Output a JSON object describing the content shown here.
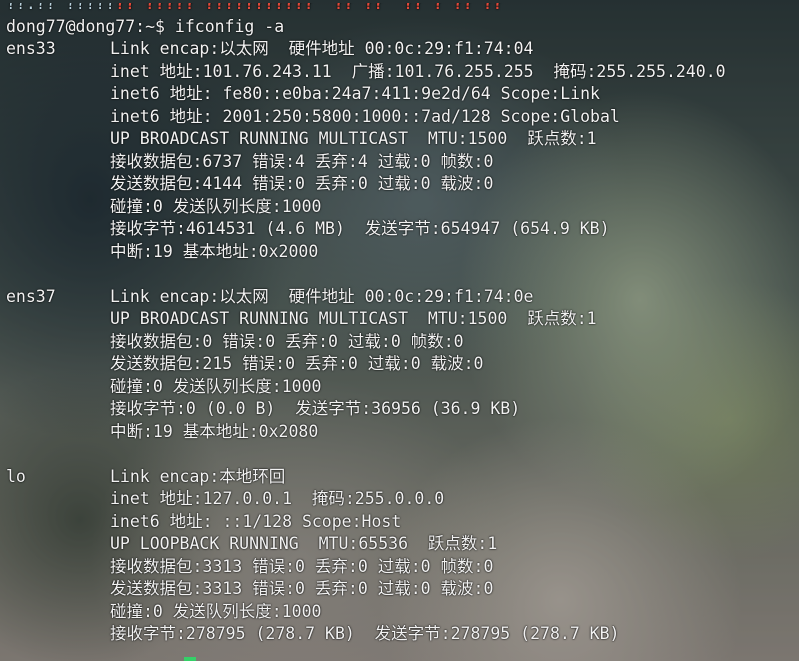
{
  "terminal": {
    "prev_line_prefix": "??:?? ?????",
    "prev_line_text": "?? ????? ???????????  ?? ??  ?? ? ?? ??",
    "prompt": "dong77@dong77:~$ ",
    "command": "ifconfig -a",
    "cursor_color": "#35d068",
    "accent_color": "#e24a3a"
  },
  "interfaces": [
    {
      "name": "ens33",
      "first_line": "Link encap:以太网  硬件地址 00:0c:29:f1:74:04",
      "lines": [
        "inet 地址:101.76.243.11  广播:101.76.255.255  掩码:255.255.240.0",
        "inet6 地址: fe80::e0ba:24a7:411:9e2d/64 Scope:Link",
        "inet6 地址: 2001:250:5800:1000::7ad/128 Scope:Global",
        "UP BROADCAST RUNNING MULTICAST  MTU:1500  跃点数:1",
        "接收数据包:6737 错误:4 丢弃:4 过载:0 帧数:0",
        "发送数据包:4144 错误:0 丢弃:0 过载:0 载波:0",
        "碰撞:0 发送队列长度:1000",
        "接收字节:4614531 (4.6 MB)  发送字节:654947 (654.9 KB)",
        "中断:19 基本地址:0x2000"
      ]
    },
    {
      "name": "ens37",
      "first_line": "Link encap:以太网  硬件地址 00:0c:29:f1:74:0e",
      "lines": [
        "UP BROADCAST RUNNING MULTICAST  MTU:1500  跃点数:1",
        "接收数据包:0 错误:0 丢弃:0 过载:0 帧数:0",
        "发送数据包:215 错误:0 丢弃:0 过载:0 载波:0",
        "碰撞:0 发送队列长度:1000",
        "接收字节:0 (0.0 B)  发送字节:36956 (36.9 KB)",
        "中断:19 基本地址:0x2080"
      ]
    },
    {
      "name": "lo",
      "first_line": "Link encap:本地环回",
      "lines": [
        "inet 地址:127.0.0.1  掩码:255.0.0.0",
        "inet6 地址: ::1/128 Scope:Host",
        "UP LOOPBACK RUNNING  MTU:65536  跃点数:1",
        "接收数据包:3313 错误:0 丢弃:0 过载:0 帧数:0",
        "发送数据包:3313 错误:0 丢弃:0 过载:0 载波:0",
        "碰撞:0 发送队列长度:1000",
        "接收字节:278795 (278.7 KB)  发送字节:278795 (278.7 KB)"
      ]
    }
  ]
}
